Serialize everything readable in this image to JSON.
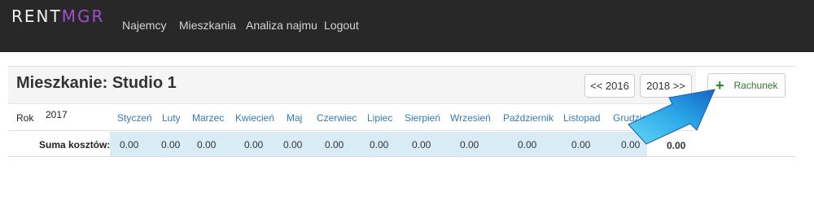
{
  "app": {
    "logo_part1": "RENT",
    "logo_part2": "MGR"
  },
  "nav": {
    "items": [
      {
        "label": "Najemcy"
      },
      {
        "label": "Mieszkania"
      },
      {
        "label": "Analiza najmu"
      },
      {
        "label": "Logout"
      }
    ]
  },
  "page": {
    "title": "Mieszkanie: Studio 1",
    "prev_year_button": "<< 2016",
    "next_year_button": "2018 >>",
    "add_button": "Rachunek"
  },
  "table": {
    "year_label": "Rok",
    "year": "2017",
    "months": [
      "Styczeń",
      "Luty",
      "Marzec",
      "Kwiecień",
      "Maj",
      "Czerwiec",
      "Lipiec",
      "Sierpień",
      "Wrzesień",
      "Październik",
      "Listopad",
      "Grudzień"
    ],
    "sum_label": "Suma kosztów:",
    "values": [
      "0.00",
      "0.00",
      "0.00",
      "0.00",
      "0.00",
      "0.00",
      "0.00",
      "0.00",
      "0.00",
      "0.00",
      "0.00",
      "0.00"
    ],
    "total": "0.00"
  },
  "colors": {
    "navbar": "#282828",
    "logo_accent": "#a24ec9",
    "link": "#337ab7",
    "sum_row": "#d9ecf5",
    "add_icon": "#1f8b1f"
  }
}
